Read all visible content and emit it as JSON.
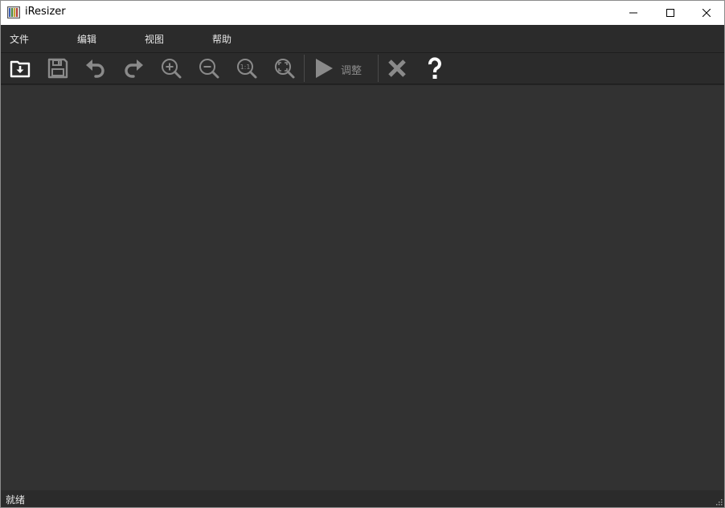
{
  "window": {
    "title": "iResizer"
  },
  "menubar": {
    "items": [
      {
        "label": "文件"
      },
      {
        "label": "编辑"
      },
      {
        "label": "视图"
      },
      {
        "label": "帮助"
      }
    ]
  },
  "toolbar": {
    "run_label": "调整",
    "icons": [
      "open-icon",
      "save-icon",
      "undo-icon",
      "redo-icon",
      "zoom-in-icon",
      "zoom-out-icon",
      "zoom-actual-icon",
      "zoom-fit-icon",
      "play-icon",
      "close-x-icon",
      "help-icon"
    ]
  },
  "statusbar": {
    "text": "就绪"
  },
  "colors": {
    "background": "#2e2e2e",
    "canvas": "#323232",
    "icon_active": "#ffffff",
    "icon_disabled": "#8a8a8a",
    "text": "#e6e6e6"
  }
}
